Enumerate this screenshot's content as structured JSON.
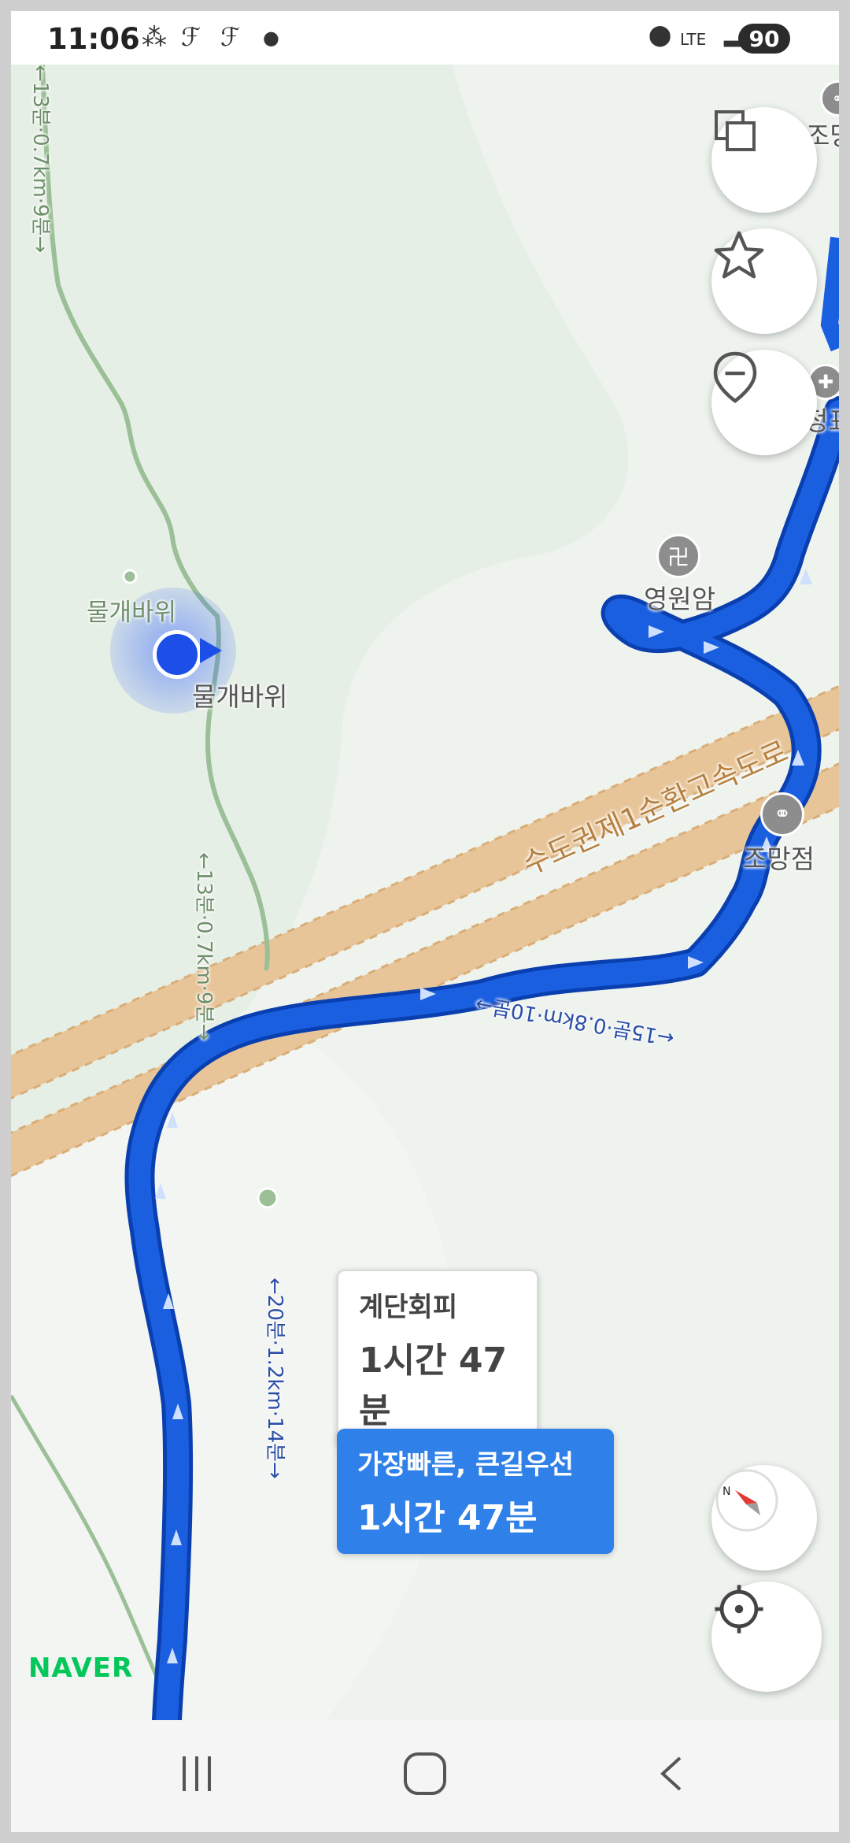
{
  "status_bar": {
    "time": "11:06",
    "network": "LTE",
    "battery": "90"
  },
  "map": {
    "poi": {
      "rock_label_upper": "물개바위",
      "rock_label_lower": "물개바위",
      "temple": "영원암",
      "viewpoint": "조망점",
      "viewpoint_top_partial": "조망",
      "shelter_partial": "정표"
    },
    "trail_labels": {
      "left_upper": "←13분·0.7km·9분→",
      "left_middle": "←13분·0.7km·9분→",
      "route_mid": "←15분·0.8km·10분→",
      "route_lower": "←20분·1.2km·14분→"
    },
    "highway_label": "수도권제1순환고속도로"
  },
  "route_callouts": {
    "stairs_avoid": {
      "name": "계단회피",
      "time": "1시간 47분"
    },
    "fastest": {
      "name": "가장빠른, 큰길우선",
      "time": "1시간 47분"
    }
  },
  "brand": "NAVER",
  "colors": {
    "route_blue": "#1a5fe0",
    "route_dark": "#0a3fb0",
    "trail_green": "#9bbf97",
    "highway_tan": "#e8c598",
    "callout_blue": "#2f80e8",
    "naver_green": "#03c75a"
  },
  "buttons": {
    "layers": "layers-icon",
    "favorite": "star-icon",
    "location_minus": "location-pin-icon",
    "compass": "compass-icon",
    "current_location": "crosshair-icon"
  }
}
